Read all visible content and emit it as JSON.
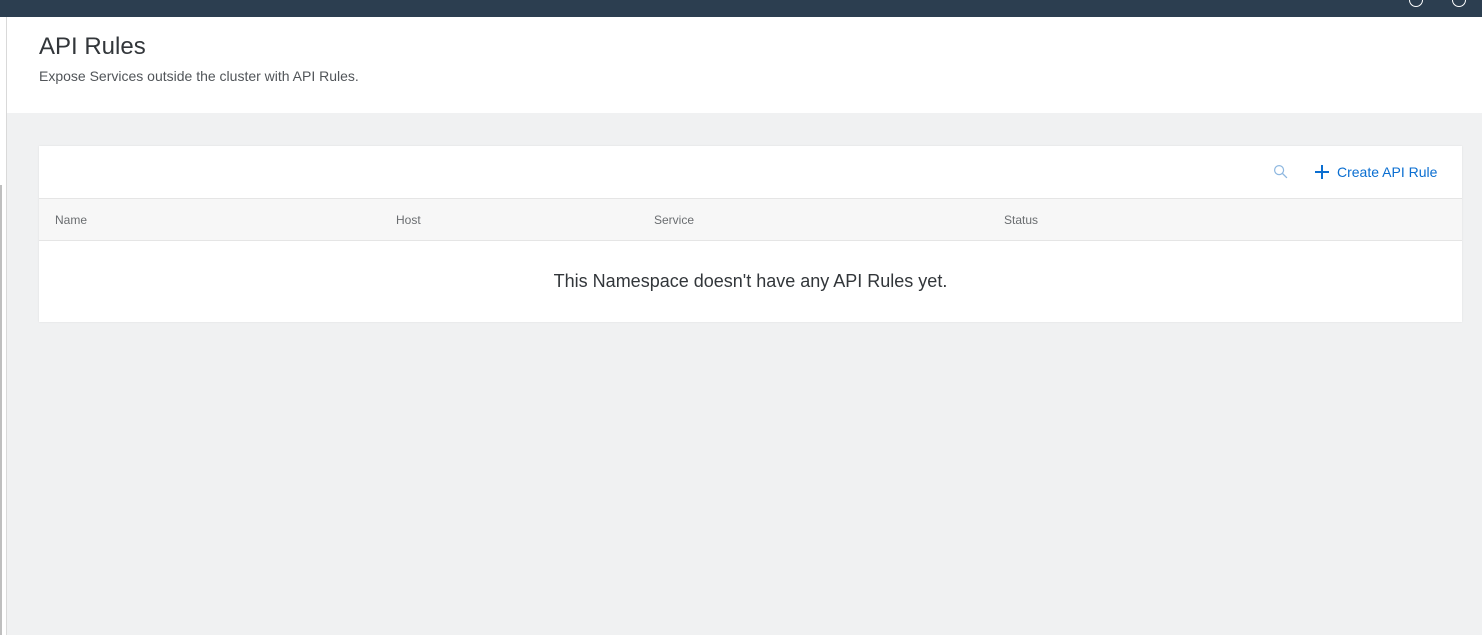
{
  "page": {
    "title": "API Rules",
    "subtitle": "Expose Services outside the cluster with API Rules."
  },
  "toolbar": {
    "search_icon": "search-icon",
    "create_label": "Create API Rule",
    "create_icon": "plus-icon"
  },
  "table": {
    "columns": [
      "Name",
      "Host",
      "Service",
      "Status"
    ],
    "empty_message": "This Namespace doesn't have any API Rules yet."
  },
  "colors": {
    "topbar": "#2c3e50",
    "accent": "#0a6ed1",
    "background": "#f0f1f2"
  }
}
